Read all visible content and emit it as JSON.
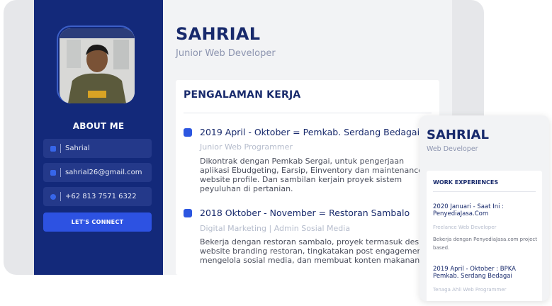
{
  "sidebar": {
    "about_title": "ABOUT ME",
    "name": "Sahrial",
    "email": "sahrial26@gmail.com",
    "phone": "+62 813 7571 6322",
    "connect_label": "LET'S CONNECT",
    "accent_color": "#2d52e2"
  },
  "main": {
    "name": "SAHRIAL",
    "role": "Junior Web Developer",
    "section_title": "PENGALAMAN KERJA",
    "experiences": [
      {
        "title": "2019 April - Oktober = Pemkab. Serdang Bedagai",
        "position": "Junior Web Programmer",
        "description": "Dikontrak dengan Pemkab Sergai, untuk pengerjaan aplikasi Ebudgeting, Earsip, Einventory dan maintenance website profile. Dan sambilan kerjain proyek sistem peyuluhan di pertanian."
      },
      {
        "title": "2018 Oktober - November = Restoran Sambalo",
        "position": "Digital Marketing | Admin Sosial Media",
        "description": "Bekerja dengan restoran sambalo, proyek termasuk design website branding restoran, tingkatakan post engagement, mengelola sosial media, dan membuat konten makanan."
      }
    ]
  },
  "preview": {
    "name": "SAHRIAL",
    "role": "Web Developer",
    "section_title": "WORK EXPERIENCES",
    "experiences": [
      {
        "title": "2020 Januari - Saat Ini : PenyediaJasa.Com",
        "position": "Freelance Web Developer",
        "description": "Bekerja dengan PenyediaJasa.com project based."
      },
      {
        "title": "2019 April - Oktober : BPKA Pemkab. Serdang Bedagai",
        "position": "Tenaga Ahli Web Programmer"
      }
    ]
  },
  "colors": {
    "navy": "#13297a",
    "heading": "#182a6c",
    "accent": "#2d52e2"
  }
}
